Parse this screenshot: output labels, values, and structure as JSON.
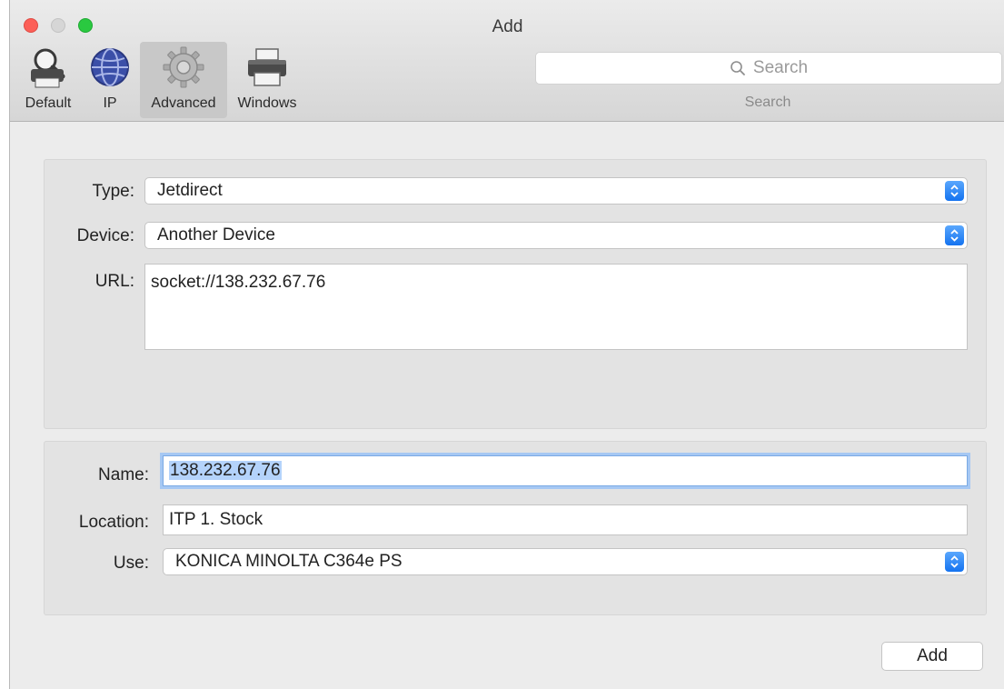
{
  "window": {
    "title": "Add"
  },
  "toolbar": {
    "items": [
      {
        "label": "Default",
        "icon": "default-printer-icon"
      },
      {
        "label": "IP",
        "icon": "globe-icon"
      },
      {
        "label": "Advanced",
        "icon": "gear-icon",
        "selected": true
      },
      {
        "label": "Windows",
        "icon": "printer-icon"
      }
    ],
    "search": {
      "placeholder": "Search",
      "caption": "Search"
    }
  },
  "form_top": {
    "type_label": "Type:",
    "type_value": "Jetdirect",
    "device_label": "Device:",
    "device_value": "Another Device",
    "url_label": "URL:",
    "url_value": "socket://138.232.67.76"
  },
  "form_bottom": {
    "name_label": "Name:",
    "name_value": "138.232.67.76",
    "location_label": "Location:",
    "location_value": "ITP 1. Stock",
    "use_label": "Use:",
    "use_value": "KONICA MINOLTA C364e PS"
  },
  "actions": {
    "add_label": "Add"
  },
  "colors": {
    "accent": "#1473f0",
    "selection": "#b4d3fb",
    "focus_ring": "#a6c8f3"
  }
}
